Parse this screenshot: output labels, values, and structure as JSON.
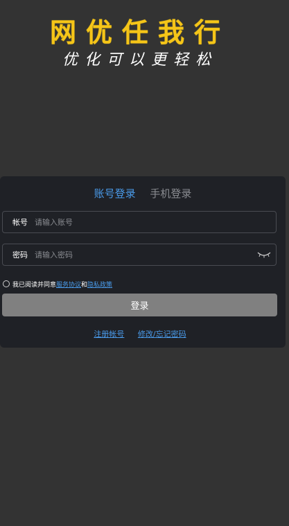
{
  "hero": {
    "title": "网优任我行",
    "slogan": "优化可以更轻松"
  },
  "tabs": [
    {
      "label": "账号登录",
      "active": true
    },
    {
      "label": "手机登录",
      "active": false
    }
  ],
  "account_field": {
    "label": "帐号",
    "placeholder": "请输入账号",
    "value": ""
  },
  "password_field": {
    "label": "密码",
    "placeholder": "请输入密码",
    "value": "",
    "toggle_icon": "eye-closed-icon"
  },
  "agreement": {
    "checked": false,
    "prefix": "我已阅读并同意",
    "service_link": "服务协议",
    "conjunction": "和",
    "privacy_link": "隐私政策"
  },
  "login_button": {
    "label": "登录"
  },
  "footer": {
    "register_link": "注册帐号",
    "reset_link": "修改/忘记密码"
  },
  "colors": {
    "background": "#333333",
    "card": "#1f2126",
    "title": "#f5c518",
    "accent": "#4a9bea",
    "button": "#808080"
  }
}
